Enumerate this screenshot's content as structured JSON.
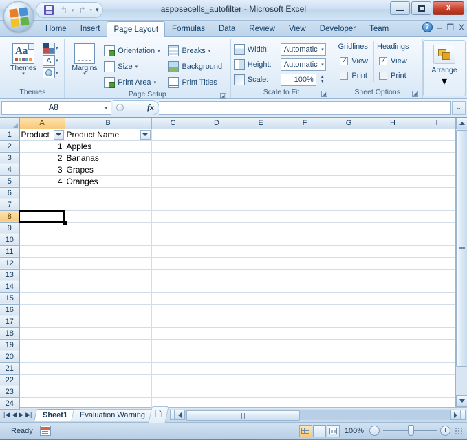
{
  "window": {
    "title": "asposecells_autofilter - Microsoft Excel",
    "buttons": {
      "minimize": "minimize-icon",
      "maximize": "maximize-icon",
      "close": "X"
    }
  },
  "quick_access": {
    "save": "save-icon",
    "undo": "↰",
    "redo": "↱",
    "customize": "customize-qat-icon"
  },
  "ribbon": {
    "tabs": [
      {
        "label": "Home",
        "active": false
      },
      {
        "label": "Insert",
        "active": false
      },
      {
        "label": "Page Layout",
        "active": true
      },
      {
        "label": "Formulas",
        "active": false
      },
      {
        "label": "Data",
        "active": false
      },
      {
        "label": "Review",
        "active": false
      },
      {
        "label": "View",
        "active": false
      },
      {
        "label": "Developer",
        "active": false
      },
      {
        "label": "Team",
        "active": false
      }
    ],
    "window_controls": {
      "help": "?",
      "minimize_ribbon": "–",
      "restore": "❐",
      "close_doc": "X"
    },
    "groups": {
      "themes": {
        "title": "Themes",
        "main_button": "Themes",
        "dropdown": "▾",
        "mini": [
          "theme-colors",
          "theme-fonts",
          "theme-effects"
        ],
        "font_glyph": "A",
        "aa_glyph": "Aa"
      },
      "page_setup": {
        "title": "Page Setup",
        "margins": "Margins",
        "margins_dropdown": "▾",
        "items": [
          {
            "label": "Orientation",
            "dropdown": "▾"
          },
          {
            "label": "Size",
            "dropdown": "▾"
          },
          {
            "label": "Print Area",
            "dropdown": "▾"
          },
          {
            "label": "Breaks",
            "dropdown": "▾"
          },
          {
            "label": "Background",
            "dropdown": ""
          },
          {
            "label": "Print Titles",
            "dropdown": ""
          }
        ],
        "launcher": "◢"
      },
      "scale_to_fit": {
        "title": "Scale to Fit",
        "rows": [
          {
            "label": "Width:",
            "value": "Automatic",
            "type": "dropdown"
          },
          {
            "label": "Height:",
            "value": "Automatic",
            "type": "dropdown"
          },
          {
            "label": "Scale:",
            "value": "100%",
            "type": "spinner"
          }
        ],
        "launcher": "◢"
      },
      "sheet_options": {
        "title": "Sheet Options",
        "columns": [
          {
            "header": "Gridlines",
            "options": [
              {
                "label": "View",
                "checked": true
              },
              {
                "label": "Print",
                "checked": false
              }
            ]
          },
          {
            "header": "Headings",
            "options": [
              {
                "label": "View",
                "checked": true
              },
              {
                "label": "Print",
                "checked": false
              }
            ]
          }
        ],
        "launcher": "◢"
      },
      "arrange": {
        "title": "",
        "label": "Arrange",
        "dropdown": "▾"
      }
    }
  },
  "formula_bar": {
    "name_box_value": "A8",
    "name_box_caret": "▾",
    "fx_label": "fx",
    "formula_value": "",
    "expand_caret": "⌄"
  },
  "grid": {
    "columns": [
      "A",
      "B",
      "C",
      "D",
      "E",
      "F",
      "G",
      "H",
      "I"
    ],
    "selected_column": "A",
    "selected_row": 8,
    "selected_cell": "A8",
    "rows": [
      {
        "num": "1",
        "cells": [
          "Product",
          "Product Name",
          "",
          "",
          "",
          "",
          "",
          "",
          ""
        ],
        "header_row": true
      },
      {
        "num": "2",
        "cells": [
          "1",
          "Apples",
          "",
          "",
          "",
          "",
          "",
          "",
          ""
        ]
      },
      {
        "num": "3",
        "cells": [
          "2",
          "Bananas",
          "",
          "",
          "",
          "",
          "",
          "",
          ""
        ]
      },
      {
        "num": "4",
        "cells": [
          "3",
          "Grapes",
          "",
          "",
          "",
          "",
          "",
          "",
          ""
        ]
      },
      {
        "num": "5",
        "cells": [
          "4",
          "Oranges",
          "",
          "",
          "",
          "",
          "",
          "",
          ""
        ]
      },
      {
        "num": "6",
        "cells": [
          "",
          "",
          "",
          "",
          "",
          "",
          "",
          "",
          ""
        ]
      },
      {
        "num": "7",
        "cells": [
          "",
          "",
          "",
          "",
          "",
          "",
          "",
          "",
          ""
        ]
      },
      {
        "num": "8",
        "cells": [
          "",
          "",
          "",
          "",
          "",
          "",
          "",
          "",
          ""
        ]
      },
      {
        "num": "9",
        "cells": [
          "",
          "",
          "",
          "",
          "",
          "",
          "",
          "",
          ""
        ]
      },
      {
        "num": "10",
        "cells": [
          "",
          "",
          "",
          "",
          "",
          "",
          "",
          "",
          ""
        ]
      },
      {
        "num": "11",
        "cells": [
          "",
          "",
          "",
          "",
          "",
          "",
          "",
          "",
          ""
        ]
      },
      {
        "num": "12",
        "cells": [
          "",
          "",
          "",
          "",
          "",
          "",
          "",
          "",
          ""
        ]
      },
      {
        "num": "13",
        "cells": [
          "",
          "",
          "",
          "",
          "",
          "",
          "",
          "",
          ""
        ]
      },
      {
        "num": "14",
        "cells": [
          "",
          "",
          "",
          "",
          "",
          "",
          "",
          "",
          ""
        ]
      },
      {
        "num": "15",
        "cells": [
          "",
          "",
          "",
          "",
          "",
          "",
          "",
          "",
          ""
        ]
      },
      {
        "num": "16",
        "cells": [
          "",
          "",
          "",
          "",
          "",
          "",
          "",
          "",
          ""
        ]
      },
      {
        "num": "17",
        "cells": [
          "",
          "",
          "",
          "",
          "",
          "",
          "",
          "",
          ""
        ]
      },
      {
        "num": "18",
        "cells": [
          "",
          "",
          "",
          "",
          "",
          "",
          "",
          "",
          ""
        ]
      },
      {
        "num": "19",
        "cells": [
          "",
          "",
          "",
          "",
          "",
          "",
          "",
          "",
          ""
        ]
      },
      {
        "num": "20",
        "cells": [
          "",
          "",
          "",
          "",
          "",
          "",
          "",
          "",
          ""
        ]
      },
      {
        "num": "21",
        "cells": [
          "",
          "",
          "",
          "",
          "",
          "",
          "",
          "",
          ""
        ]
      },
      {
        "num": "22",
        "cells": [
          "",
          "",
          "",
          "",
          "",
          "",
          "",
          "",
          ""
        ]
      },
      {
        "num": "23",
        "cells": [
          "",
          "",
          "",
          "",
          "",
          "",
          "",
          "",
          ""
        ]
      },
      {
        "num": "24",
        "cells": [
          "",
          "",
          "",
          "",
          "",
          "",
          "",
          "",
          ""
        ]
      }
    ],
    "autofilter_columns": [
      "A",
      "B"
    ]
  },
  "sheet_tabs": {
    "nav": {
      "first": "|◀",
      "prev": "◀",
      "next": "▶",
      "last": "▶|"
    },
    "tabs": [
      {
        "label": "Sheet1",
        "active": true
      },
      {
        "label": "Evaluation Warning",
        "active": false
      }
    ],
    "new_sheet": "new-sheet-icon"
  },
  "status_bar": {
    "status": "Ready",
    "record_macro": "record-macro-icon",
    "views": [
      {
        "name": "normal-view",
        "active": true
      },
      {
        "name": "page-layout-view",
        "active": false
      },
      {
        "name": "page-break-preview",
        "active": false
      }
    ],
    "zoom_level": "100%",
    "zoom_out": "−",
    "zoom_in": "+"
  }
}
